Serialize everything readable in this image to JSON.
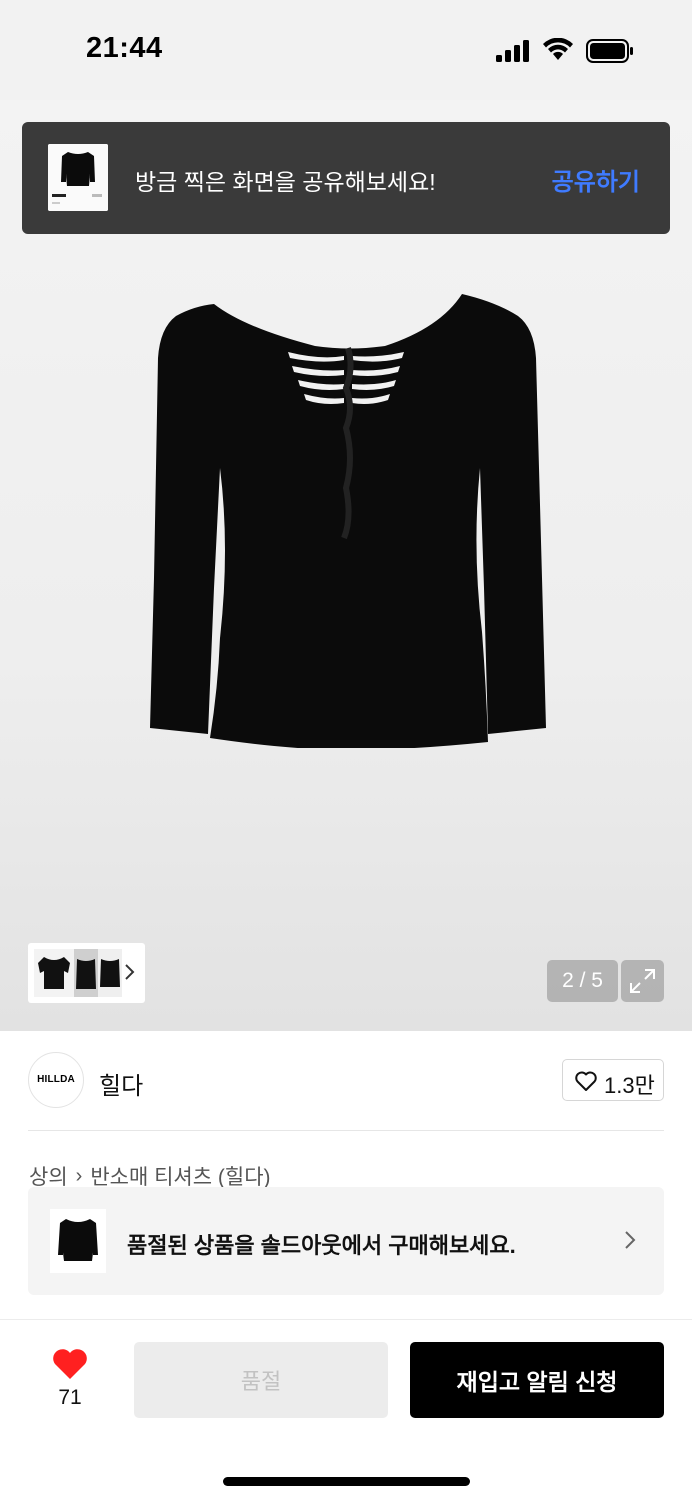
{
  "status_bar": {
    "time": "21:44"
  },
  "share_banner": {
    "text": "방금 찍은 화면을 공유해보세요!",
    "button_label": "공유하기"
  },
  "gallery": {
    "page_indicator": "2 / 5"
  },
  "brand": {
    "logo_text": "HILLDA",
    "name": "힐다",
    "likes": "1.3만"
  },
  "breadcrumb": {
    "items": [
      "상의",
      "반소매 티셔츠 (힐다)"
    ]
  },
  "soldout_notice": {
    "text": "품절된 상품을 솔드아웃에서 구매해보세요."
  },
  "bottom_bar": {
    "wish_count": "71",
    "soldout_label": "품절",
    "restock_label": "재입고 알림 신청"
  },
  "colors": {
    "accent_blue": "#3f7bff",
    "heart_red": "#ff2020",
    "primary_black": "#000000"
  }
}
